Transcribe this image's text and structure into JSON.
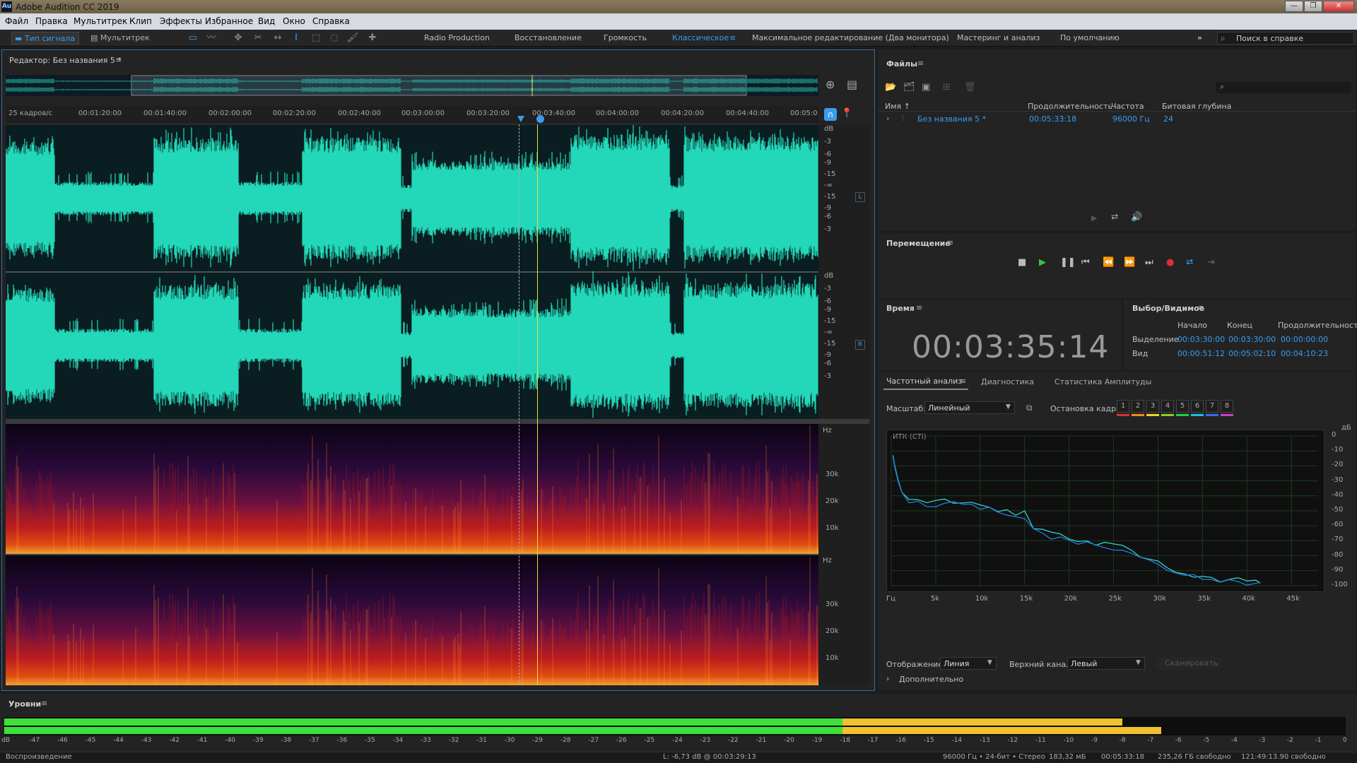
{
  "window": {
    "title": "Adobe Audition CC 2019",
    "icon": "Au"
  },
  "menu": [
    "Файл",
    "Правка",
    "Мультитрек",
    "Клип",
    "Эффекты",
    "Избранное",
    "Вид",
    "Окно",
    "Справка"
  ],
  "toolbar": {
    "waveform_label": "Тип сигнала",
    "multitrack_label": "Мультитрек",
    "workspaces": [
      "Radio Production",
      "Восстановление",
      "Громкость",
      "Классическое",
      "Максимальное редактирование (Два монитора)",
      "Мастеринг и анализ",
      "По умолчанию"
    ],
    "active_workspace": "Классическое",
    "search_placeholder": "Поиск в справке"
  },
  "editor": {
    "title": "Редактор: Без названия 5 *",
    "timecode_unit": "25 кадров/с",
    "time_ticks": [
      "00:01:20:00",
      "00:01:40:00",
      "00:02:00:00",
      "00:02:20:00",
      "00:02:40:00",
      "00:03:00:00",
      "00:03:20:00",
      "00:03:40:00",
      "00:04:00:00",
      "00:04:20:00",
      "00:04:40:00",
      "00:05:0"
    ],
    "db_ticks": [
      "dB",
      "-3",
      "-6",
      "-9",
      "-15",
      "-∞",
      "-15",
      "-9",
      "-6",
      "-3"
    ],
    "channel_labels": [
      "L",
      "R"
    ],
    "hz_label": "Hz",
    "hz_ticks": [
      "30k",
      "20k",
      "10k"
    ]
  },
  "files": {
    "title": "Файлы",
    "columns": [
      "Имя ↑",
      "Продолжительность",
      "Частота",
      "Битовая глубина"
    ],
    "rows": [
      {
        "name": "Без названия 5 *",
        "duration": "00:05:33:18",
        "rate": "96000 Гц",
        "depth": "24"
      }
    ]
  },
  "transport": {
    "title": "Перемещение"
  },
  "time": {
    "title": "Время",
    "value": "00:03:35:14"
  },
  "selection": {
    "title": "Выбор/Видимое",
    "columns": [
      "Начало",
      "Конец",
      "Продолжительность"
    ],
    "rows": [
      {
        "label": "Выделение",
        "start": "00:03:30:00",
        "end": "00:03:30:00",
        "dur": "00:00:00:00"
      },
      {
        "label": "Вид",
        "start": "00:00:51:12",
        "end": "00:05:02:10",
        "dur": "00:04:10:23"
      }
    ]
  },
  "analysis": {
    "tabs": [
      "Частотный анализ",
      "Диагностика",
      "Статистика Амплитуды"
    ],
    "scale_label": "Масштаб:",
    "scale_value": "Линейный",
    "hold_label": "Остановка кадра:",
    "hold_buttons": [
      "1",
      "2",
      "3",
      "4",
      "5",
      "6",
      "7",
      "8"
    ],
    "hold_colors": [
      "#e0302a",
      "#f08a1a",
      "#f2d21a",
      "#8ad21a",
      "#1ad24a",
      "#1ac2e0",
      "#3a6af0",
      "#d03ad2"
    ],
    "graph_label": "ИТК (СТI)",
    "y_unit": "дБ",
    "display_label": "Отображение:",
    "display_value": "Линия",
    "channel_label": "Верхний канал:",
    "channel_value": "Левый",
    "scan_button": "Сканировать",
    "advanced_label": "Дополнительно"
  },
  "chart_data": {
    "type": "line",
    "xlabel": "",
    "ylabel": "дБ",
    "x_ticks": [
      "Гц",
      "5k",
      "10k",
      "15k",
      "20k",
      "25k",
      "30k",
      "35k",
      "40k",
      "45k"
    ],
    "y_ticks": [
      "0",
      "-10",
      "-20",
      "-30",
      "-40",
      "-50",
      "-60",
      "-70",
      "-80",
      "-90",
      "-100"
    ],
    "xlim": [
      0,
      48000
    ],
    "ylim": [
      -100,
      0
    ],
    "series": [
      {
        "values_x": [
          200,
          400,
          800,
          1200,
          2000,
          3000,
          4000,
          5000,
          6000,
          7000,
          8000,
          9000,
          10000,
          11000,
          12000,
          13000,
          14000,
          15000,
          16000,
          17000,
          18000,
          19000,
          20000,
          21000,
          22000,
          23000,
          24000,
          25000,
          26000,
          27000,
          28000,
          29000,
          30000,
          31000,
          32000,
          33000,
          34000,
          35000,
          36000,
          37000,
          38000,
          39000,
          40000,
          41000,
          41500
        ],
        "values_y": [
          -13,
          -20,
          -30,
          -38,
          -42,
          -44,
          -46,
          -45,
          -44,
          -43,
          -45,
          -46,
          -46,
          -48,
          -49,
          -50,
          -53,
          -52,
          -60,
          -63,
          -66,
          -67,
          -69,
          -70,
          -71,
          -73,
          -72,
          -74,
          -75,
          -76,
          -79,
          -82,
          -85,
          -87,
          -90,
          -92,
          -93,
          -95,
          -95,
          -96,
          -96,
          -96,
          -97,
          -98,
          -98
        ]
      },
      {
        "values_x": [
          200,
          400,
          800,
          1200,
          2000,
          3000,
          4000,
          5000,
          6000,
          7000,
          8000,
          9000,
          10000,
          11000,
          12000,
          13000,
          14000,
          15000,
          16000,
          17000,
          18000,
          19000,
          20000,
          21000,
          22000,
          23000,
          24000,
          25000,
          26000,
          27000,
          28000,
          29000,
          30000,
          31000,
          32000,
          33000,
          34000,
          35000,
          36000,
          37000,
          38000,
          39000,
          40000,
          41000,
          41500
        ],
        "values_y": [
          -14,
          -21,
          -31,
          -39,
          -44,
          -45,
          -47,
          -46,
          -45,
          -45,
          -47,
          -47,
          -48,
          -49,
          -50,
          -52,
          -54,
          -54,
          -61,
          -64,
          -67,
          -68,
          -70,
          -71,
          -72,
          -74,
          -73,
          -75,
          -76,
          -77,
          -80,
          -84,
          -87,
          -89,
          -91,
          -93,
          -94,
          -96,
          -96,
          -97,
          -97,
          -97,
          -98,
          -98,
          -98
        ]
      }
    ],
    "colors": [
      "#2dd4c8",
      "#2a7ad8"
    ]
  },
  "levels": {
    "title": "Уровни",
    "ticks": [
      "dB",
      "-47",
      "-46",
      "-45",
      "-44",
      "-43",
      "-42",
      "-41",
      "-40",
      "-39",
      "-38",
      "-37",
      "-36",
      "-35",
      "-34",
      "-33",
      "-32",
      "-31",
      "-30",
      "-29",
      "-28",
      "-27",
      "-26",
      "-25",
      "-24",
      "-23",
      "-22",
      "-21",
      "-20",
      "-19",
      "-18",
      "-17",
      "-16",
      "-15",
      "-14",
      "-13",
      "-12",
      "-11",
      "-10",
      "-9",
      "-8",
      "-7",
      "-6",
      "-5",
      "-4",
      "-3",
      "-2",
      "-1",
      "0"
    ],
    "left_level_db": -8.0,
    "right_level_db": -6.6
  },
  "status": {
    "left": "Воспроизведение",
    "cursor": "L: -6,73 dB @ 00:03:29:13",
    "format": "96000 Гц • 24-бит • Стерео",
    "size": "183,32 мБ",
    "duration": "00:05:33:18",
    "free": "235,26 ГБ свободно",
    "free_time": "121:49:13.90 свободно"
  }
}
